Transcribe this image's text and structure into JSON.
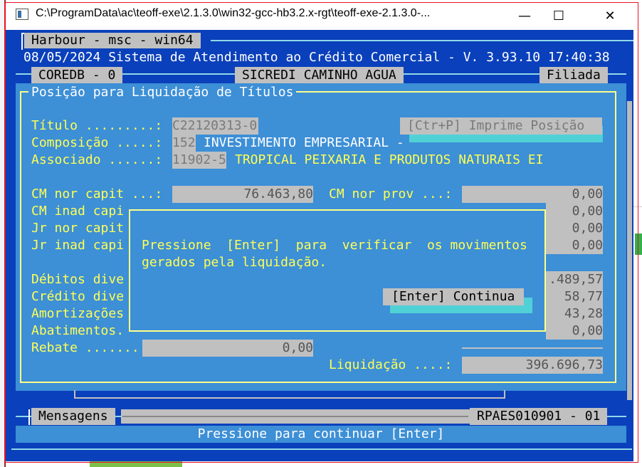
{
  "window": {
    "title": "C:\\ProgramData\\ac\\teoff-exe\\2.1.3.0\\win32-gcc-hb3.2.x-rgt\\teoff-exe-2.1.3.0-...",
    "minimize_glyph": "—",
    "maximize_glyph": "☐",
    "close_glyph": "✕"
  },
  "console": {
    "tab_label": "Harbour - msc - win64",
    "header": "08/05/2024 Sistema de Atendimento ao Crédito Comercial - V. 3.93.10 17:40:38",
    "coredb": "COREDB - 0",
    "cooperative": "SICREDI CAMINHO AGUA",
    "branch": "Filiada",
    "panel_title": "Posição para Liquidação de Títulos",
    "fields": {
      "titulo_label": "Título .........:",
      "titulo_value": "C22120313-0",
      "print_button": "[Ctr+P] Imprime Posição",
      "composicao_label": "Composição .....:",
      "composicao_code": "152",
      "composicao_name": "INVESTIMENTO EMPRESARIAL -",
      "associado_label": "Associado ......:",
      "associado_code": "11902-5",
      "associado_name": "TROPICAL PEIXARIA E PRODUTOS NATURAIS EI",
      "cm_nor_capit_label": "CM nor capit ...:",
      "cm_nor_capit_value": "76.463,80",
      "cm_nor_prov_label": "CM nor prov ...:",
      "cm_nor_prov_value": "0,00",
      "cm_inad_capi_label": "CM inad capi",
      "cm_inad_capi_value": "0,00",
      "jr_nor_capit_label": "Jr nor capit",
      "jr_nor_capit_value": "0,00",
      "jr_inad_capi_label": "Jr inad capi",
      "jr_inad_capi_value": "0,00",
      "debitos_label": "Débitos dive",
      "debitos_value": ".489,57",
      "creditos_label": "Crédito dive",
      "creditos_value": "58,77",
      "amortizacoes_label": "Amortizações",
      "amortizacoes_value": "43,28",
      "abatimentos_label": "Abatimentos.",
      "abatimentos_value": "0,00",
      "rebate_label": "Rebate .........:",
      "rebate_value": "0,00",
      "liquidacao_label": "Liquidação ....:",
      "liquidacao_value": "396.696,73"
    },
    "dialog": {
      "line1": "Pressione  [Enter]  para  verificar  os movimentos",
      "line2": "gerados pela liquidação.",
      "button": "[Enter] Continua"
    },
    "messages_label": "Mensagens",
    "program_code": "RPAES010901 - 01",
    "status": "Pressione para continuar [Enter]"
  },
  "colors": {
    "console_blue": "#0a40bb",
    "panel_blue": "#3d8fd6",
    "label_yellow": "#ffff55",
    "field_gray": "#c0c0c0",
    "cyan_shadow": "#4fd1d6"
  }
}
